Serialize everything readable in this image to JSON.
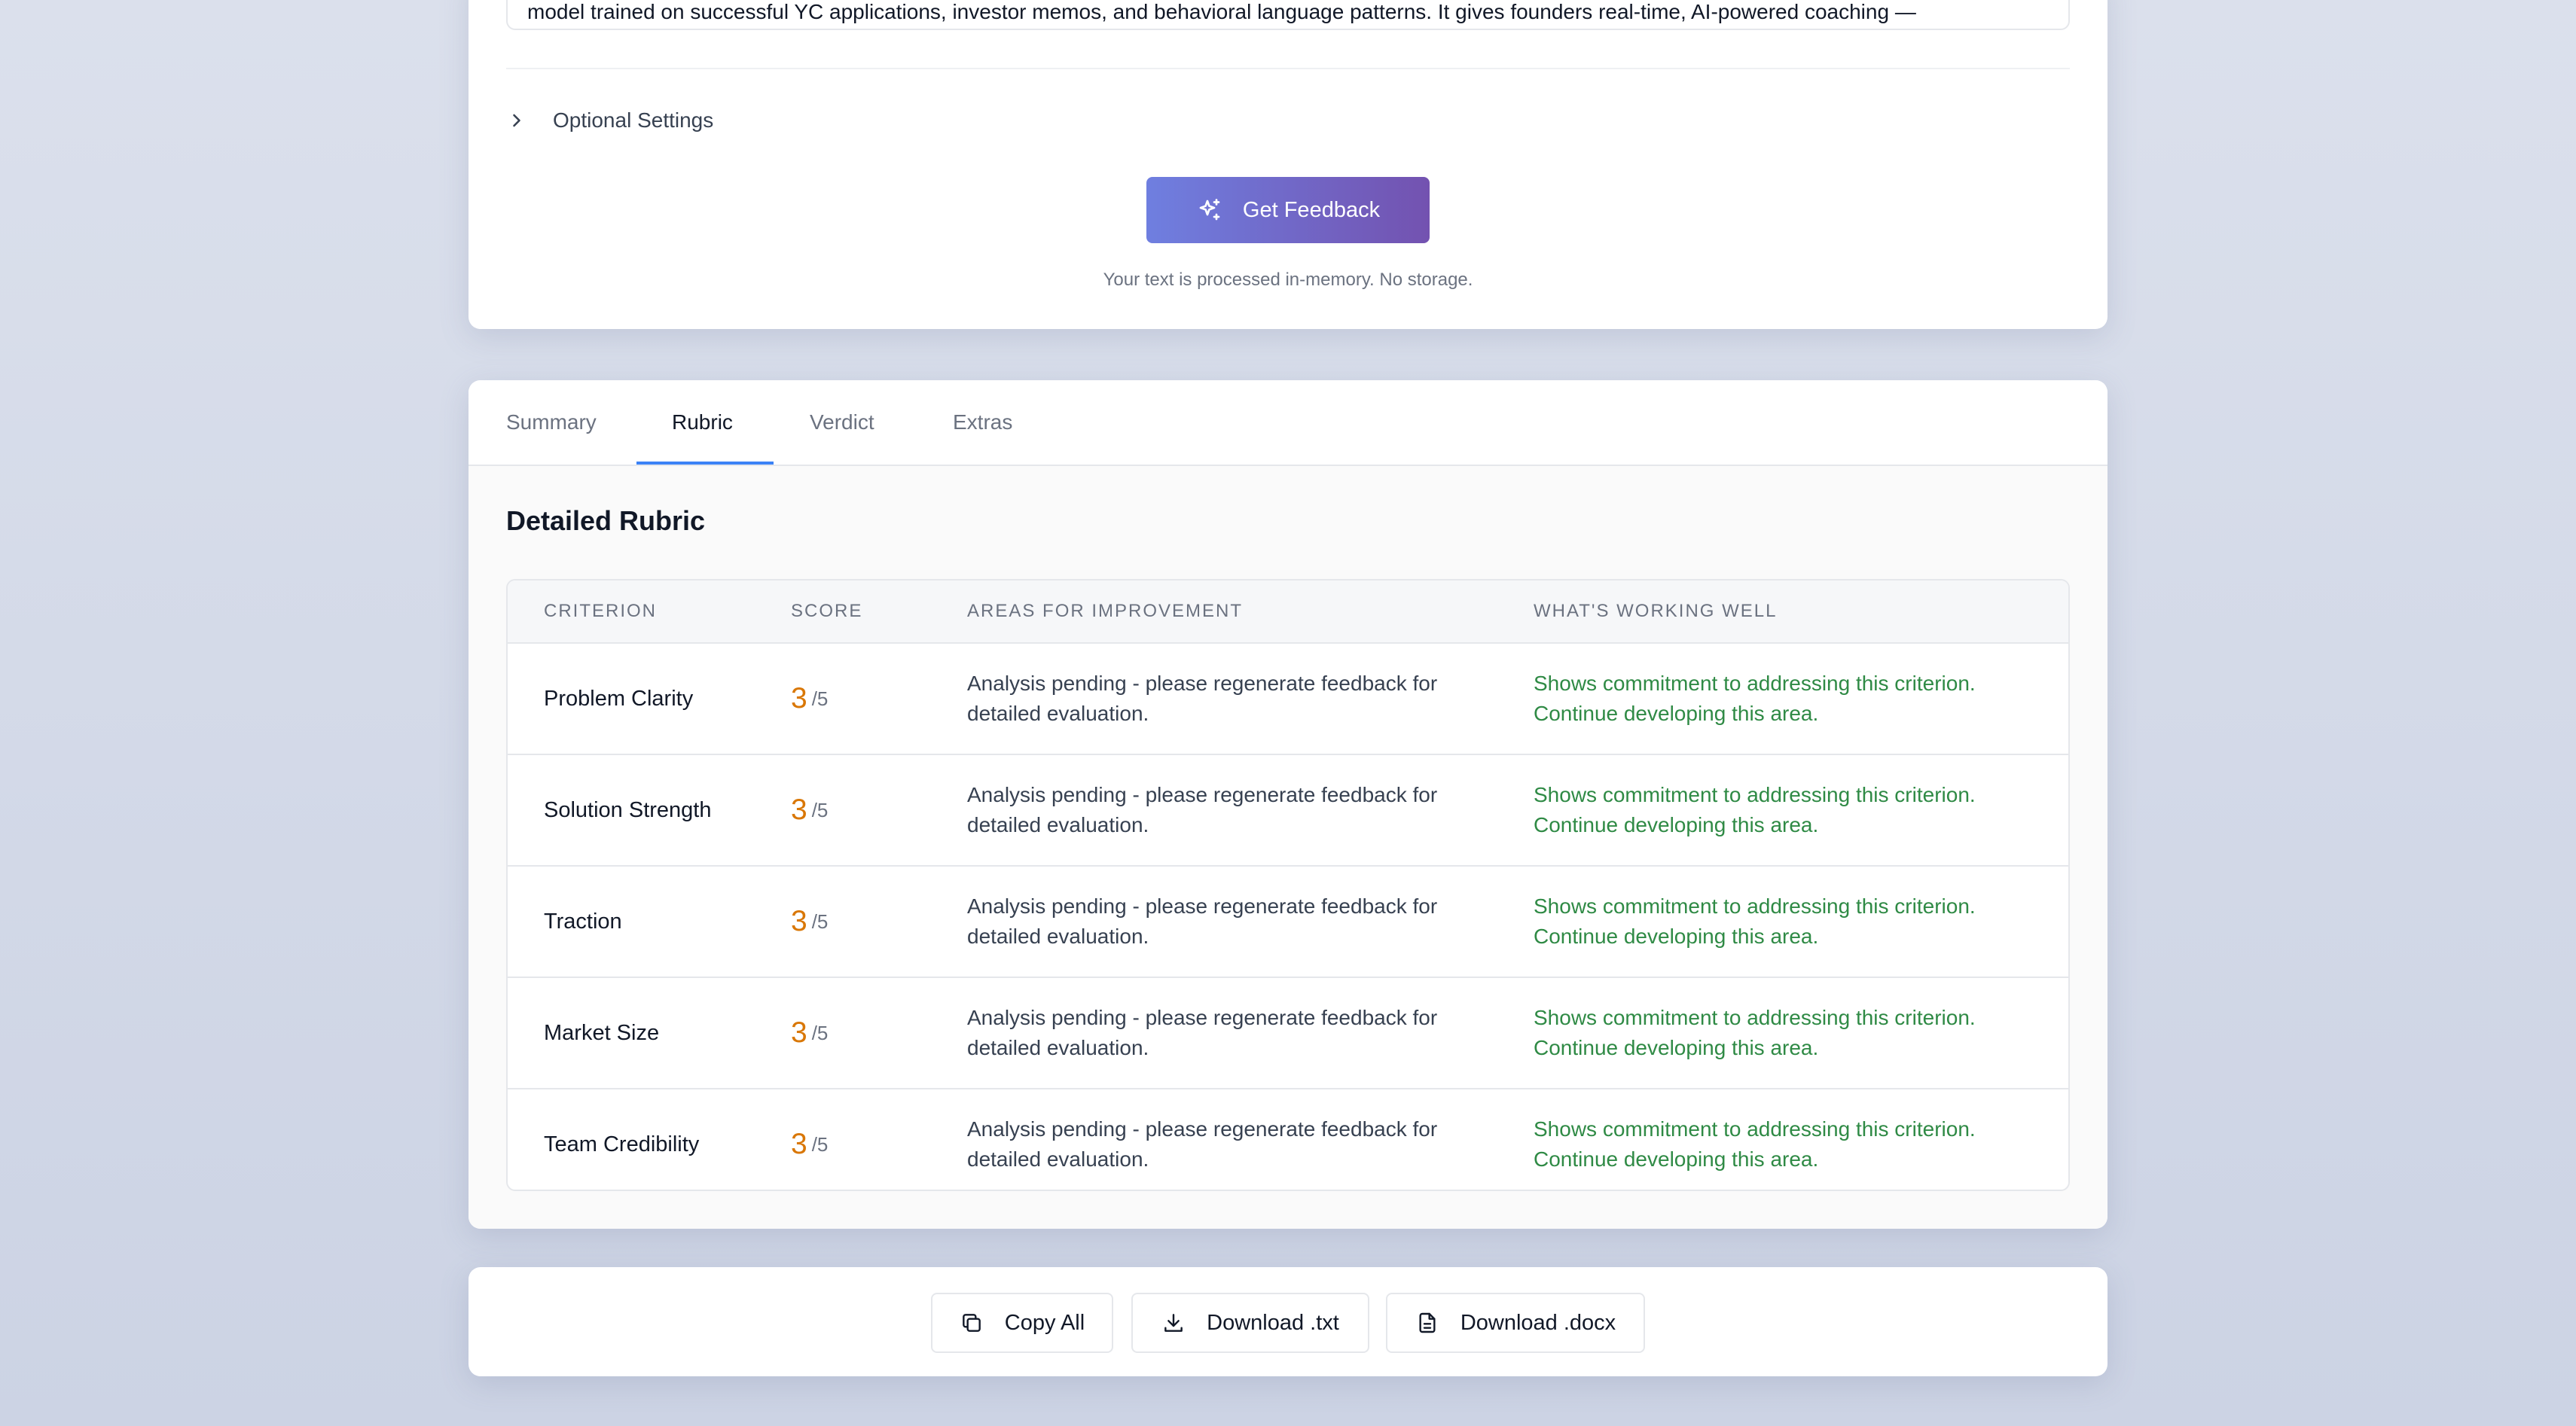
{
  "input": {
    "text": "model trained on successful YC applications, investor memos, and behavioral language patterns. It gives founders real-time, AI-powered coaching —",
    "optional_settings_label": "Optional Settings",
    "submit_label": "Get Feedback",
    "privacy_note": "Your text is processed in-memory. No storage."
  },
  "tabs": [
    {
      "label": "Summary",
      "active": false
    },
    {
      "label": "Rubric",
      "active": true
    },
    {
      "label": "Verdict",
      "active": false
    },
    {
      "label": "Extras",
      "active": false
    }
  ],
  "rubric": {
    "title": "Detailed Rubric",
    "headers": {
      "criterion": "CRITERION",
      "score": "SCORE",
      "improve": "AREAS FOR IMPROVEMENT",
      "working": "WHAT'S WORKING WELL"
    },
    "rows": [
      {
        "criterion": "Problem Clarity",
        "score": "3",
        "max": "/5",
        "improve": "Analysis pending - please regenerate feedback for detailed evaluation.",
        "working": "Shows commitment to addressing this criterion. Continue developing this area."
      },
      {
        "criterion": "Solution Strength",
        "score": "3",
        "max": "/5",
        "improve": "Analysis pending - please regenerate feedback for detailed evaluation.",
        "working": "Shows commitment to addressing this criterion. Continue developing this area."
      },
      {
        "criterion": "Traction",
        "score": "3",
        "max": "/5",
        "improve": "Analysis pending - please regenerate feedback for detailed evaluation.",
        "working": "Shows commitment to addressing this criterion. Continue developing this area."
      },
      {
        "criterion": "Market Size",
        "score": "3",
        "max": "/5",
        "improve": "Analysis pending - please regenerate feedback for detailed evaluation.",
        "working": "Shows commitment to addressing this criterion. Continue developing this area."
      },
      {
        "criterion": "Team Credibility",
        "score": "3",
        "max": "/5",
        "improve": "Analysis pending - please regenerate feedback for detailed evaluation.",
        "working": "Shows commitment to addressing this criterion. Continue developing this area."
      }
    ]
  },
  "actions": {
    "copy_label": "Copy All",
    "txt_label": "Download .txt",
    "docx_label": "Download .docx"
  },
  "colors": {
    "accent": "#3b82f6",
    "button_gradient_start": "#6f7fe0",
    "button_gradient_end": "#7352b0",
    "score": "#d97706",
    "positive": "#2f8a45"
  }
}
